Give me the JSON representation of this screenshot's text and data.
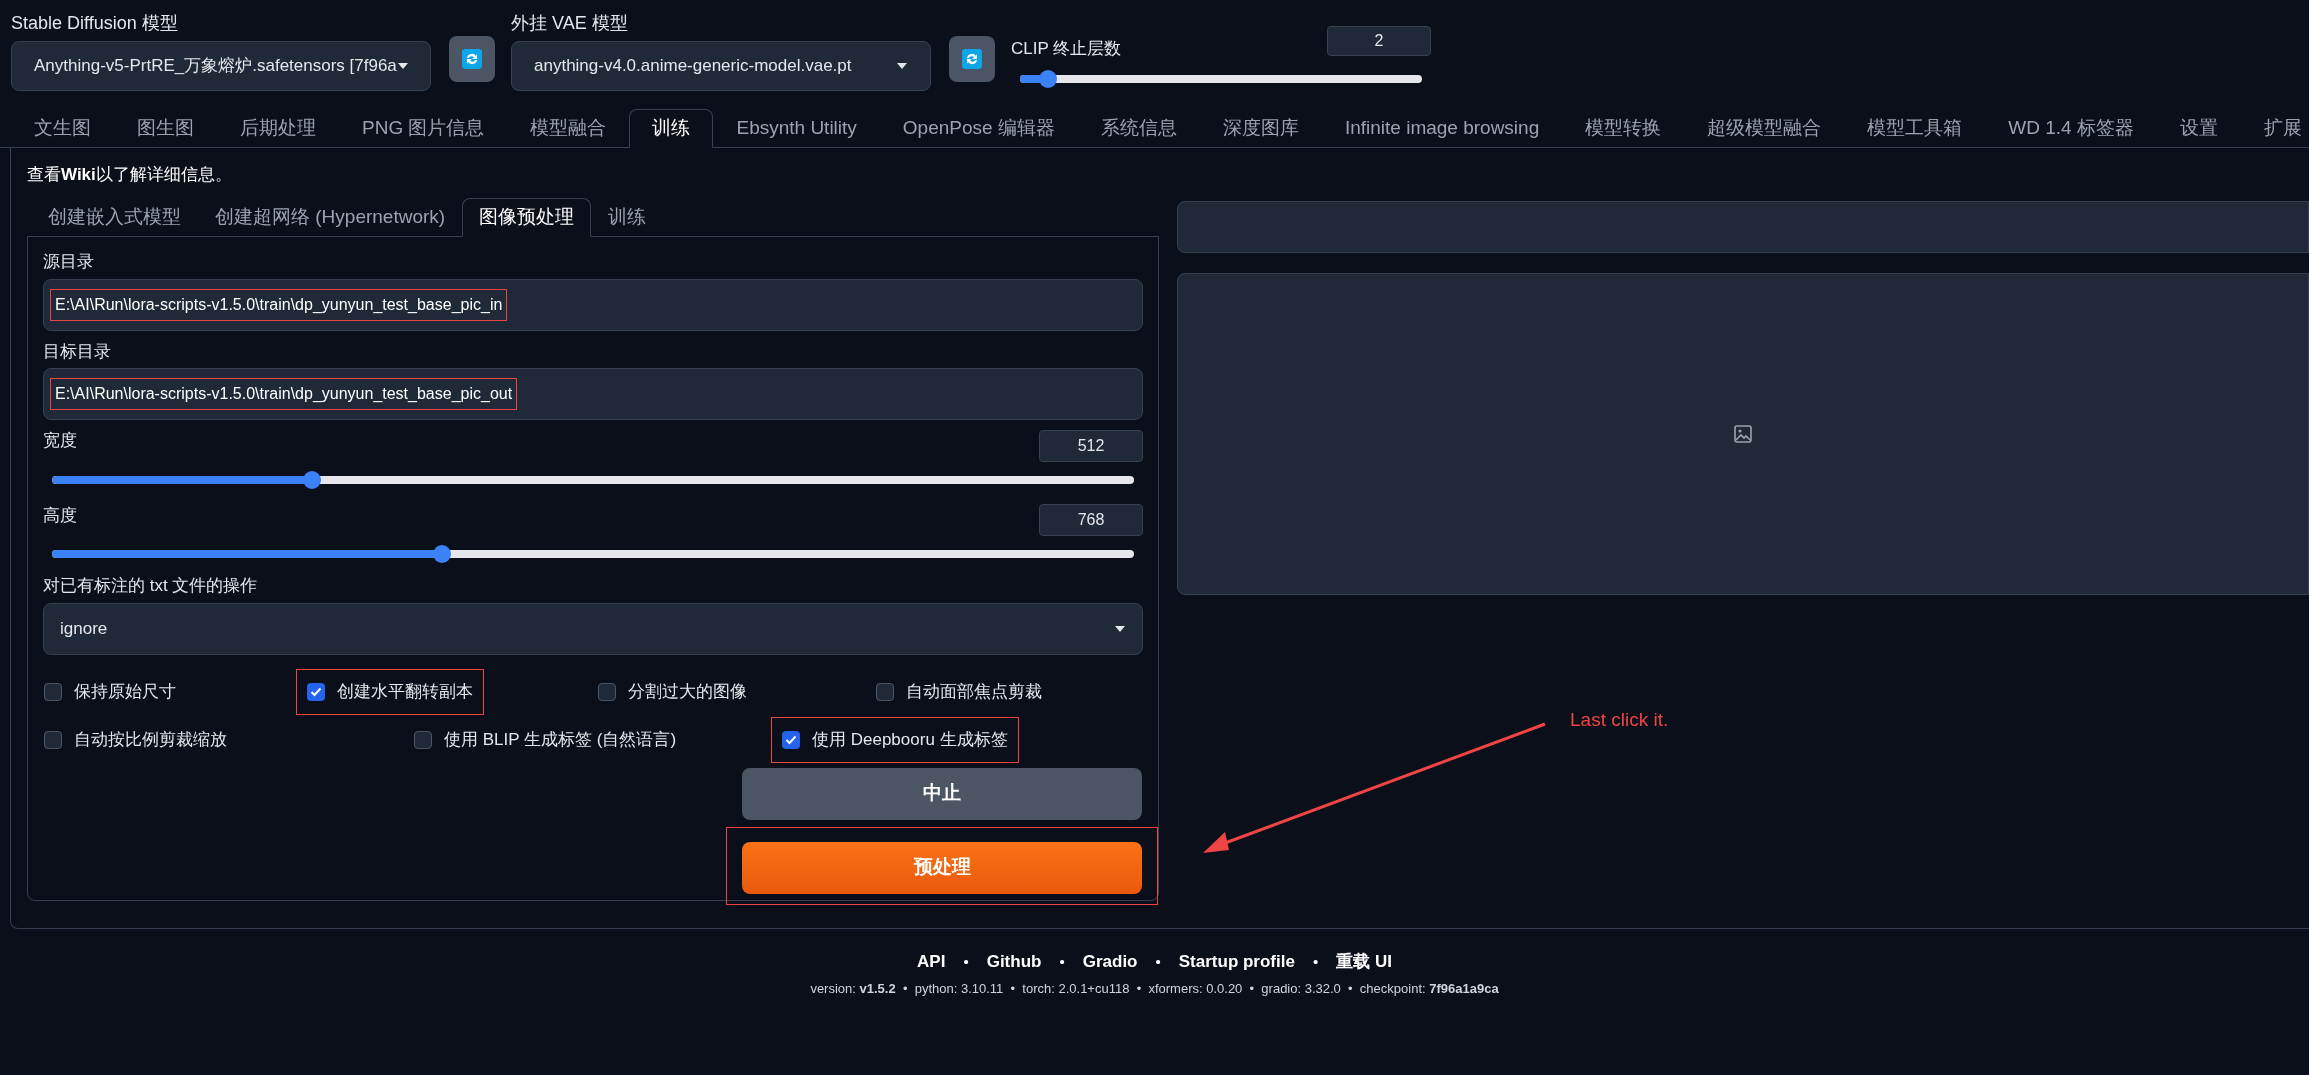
{
  "top_bar": {
    "model": {
      "label": "Stable Diffusion 模型",
      "value": "Anything-v5-PrtRE_万象熔炉.safetensors [7f96a"
    },
    "vae": {
      "label": "外挂 VAE 模型",
      "value": "anything-v4.0.anime-generic-model.vae.pt"
    },
    "clip": {
      "label": "CLIP 终止层数",
      "value": "2",
      "level": 0.07
    }
  },
  "tabs": [
    {
      "label": "文生图",
      "selected": false
    },
    {
      "label": "图生图",
      "selected": false
    },
    {
      "label": "后期处理",
      "selected": false
    },
    {
      "label": "PNG 图片信息",
      "selected": false
    },
    {
      "label": "模型融合",
      "selected": false
    },
    {
      "label": "训练",
      "selected": true
    },
    {
      "label": "Ebsynth Utility",
      "selected": false
    },
    {
      "label": "OpenPose 编辑器",
      "selected": false
    },
    {
      "label": "系统信息",
      "selected": false
    },
    {
      "label": "深度图库",
      "selected": false
    },
    {
      "label": "Infinite image browsing",
      "selected": false
    },
    {
      "label": "模型转换",
      "selected": false
    },
    {
      "label": "超级模型融合",
      "selected": false
    },
    {
      "label": "模型工具箱",
      "selected": false
    },
    {
      "label": "WD 1.4 标签器",
      "selected": false
    },
    {
      "label": "设置",
      "selected": false
    },
    {
      "label": "扩展",
      "selected": false
    }
  ],
  "info": "查看**Wiki**以了解详细信息。",
  "sub_tabs": [
    {
      "label": "创建嵌入式模型",
      "selected": false
    },
    {
      "label": "创建超网络 (Hypernetwork)",
      "selected": false
    },
    {
      "label": "图像预处理",
      "selected": true
    },
    {
      "label": "训练",
      "selected": false
    }
  ],
  "fields": [
    {
      "label": "源目录",
      "value": "E:\\AI\\Run\\lora-scripts-v1.5.0\\train\\dp_yunyun_test_base_pic_in",
      "highlighted": true
    },
    {
      "label": "目标目录",
      "value": "E:\\AI\\Run\\lora-scripts-v1.5.0\\train\\dp_yunyun_test_base_pic_out",
      "highlighted": true
    }
  ],
  "sliders": [
    {
      "label": "宽度",
      "value": "512",
      "level": 0.24
    },
    {
      "label": "高度",
      "value": "768",
      "level": 0.36
    }
  ],
  "txt_action": {
    "label": "对已有标注的 txt 文件的操作",
    "value": "ignore"
  },
  "checkbox_rows": [
    [
      {
        "label": "保持原始尺寸",
        "checked": false,
        "highlighted": false
      },
      {
        "label": "创建水平翻转副本",
        "checked": true,
        "highlighted": true
      },
      {
        "label": "分割过大的图像",
        "checked": false,
        "highlighted": false
      },
      {
        "label": "自动面部焦点剪裁",
        "checked": false,
        "highlighted": false
      }
    ],
    [
      {
        "label": "自动按比例剪裁缩放",
        "checked": false,
        "highlighted": false
      },
      {
        "label": "使用 BLIP 生成标签 (自然语言)",
        "checked": false,
        "highlighted": false
      },
      {
        "label": "使用 Deepbooru 生成标签",
        "checked": true,
        "highlighted": true
      }
    ]
  ],
  "buttons": [
    {
      "label": "中止",
      "kind": "secondary"
    },
    {
      "label": "预处理",
      "kind": "primary",
      "highlighted": true
    }
  ],
  "annotation": {
    "text": "Last click it."
  },
  "footer": {
    "links": [
      "API",
      "Github",
      "Gradio",
      "Startup profile",
      "重载 UI"
    ],
    "separators": [
      "•",
      "•",
      "•",
      "•"
    ],
    "version": "version: **v1.5.2**  •  python: 3.10.11  •  torch: 2.0.1+cu118  •  xformers: 0.0.20  •  gradio: 3.32.0  •  checkpoint: **7f96a1a9ca**"
  }
}
